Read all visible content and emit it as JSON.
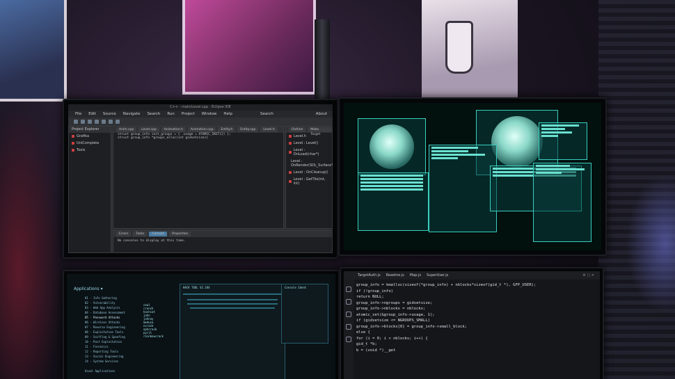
{
  "ide": {
    "window_title": "C++ - main/Level.cpp - Eclipse IDE",
    "menu": [
      "File",
      "Edit",
      "Source",
      "Navigate",
      "Search",
      "Run",
      "Project",
      "Window",
      "Help"
    ],
    "about_label": "About",
    "search_label": "Search",
    "project_explorer": {
      "title": "Project Explorer",
      "items": [
        "Grafika",
        "UniComplete",
        "Tools"
      ]
    },
    "editor_tabs": [
      "Anim.cpp",
      "Level.cpp",
      "Animation.h",
      "Animation.cpp",
      "Entity.h",
      "Entity.cpp",
      "Level.h"
    ],
    "code_lines": [
      "struct group_info init_groups = { .usage = ATOMIC_INIT(2) };",
      "struct group_info *groups_alloc(int gidsetsize){"
    ],
    "outline": {
      "tabs": [
        "Outline",
        "Make Target"
      ],
      "items": [
        "Level.h",
        "Level : Level()",
        "Level : OnLoad(char*)",
        "Level : OnRender(SDL_Surface*)",
        "Level : OnCleanup()",
        "Level : GetTile(int, int)"
      ]
    },
    "bottom_tabs": [
      "Errors",
      "Tasks",
      "Console",
      "Properties"
    ],
    "console_message": "No consoles to display at this time."
  },
  "apps": {
    "title": "Applications",
    "menu_items": [
      "01 - Info Gathering",
      "02 - Vulnerability",
      "03 - Web App Analysis",
      "04 - Database Assessment",
      "05 - Password Attacks",
      "06 - Wireless Attacks",
      "07 - Reverse Engineering",
      "08 - Exploitation Tools",
      "09 - Sniffing & Spoofing",
      "10 - Post Exploitation",
      "11 - Forensics",
      "12 - Reporting Tools",
      "13 - Social Engineering",
      "14 - System Services",
      "Usual Applications"
    ],
    "sub_items": [
      "cewl",
      "crunch",
      "hashcat",
      "john",
      "johnny",
      "medusa",
      "ncrack",
      "ophcrack",
      "pyrit",
      "rainbowcrack"
    ],
    "terminal_title": "HACK TOOL V2.184",
    "side_title": "Console Ident"
  },
  "vscode": {
    "tabs": [
      "TargetAuth.js",
      "Readme.js",
      "Map.js",
      "SuperUser.js"
    ],
    "code_lines": [
      "group_info = kmalloc(sizeof(*group_info) + nblocks*sizeof(gid_t *), GFP_USER);",
      "if (!group_info)",
      "    return NULL;",
      "",
      "group_info->ngroups = gidsetsize;",
      "group_info->nblocks = nblocks;",
      "atomic_set(&group_info->usage, 1);",
      "",
      "if (gidsetsize <= NGROUPS_SMALL)",
      "    group_info->blocks[0] = group_info->small_block;",
      "else {",
      "    for (i = 0; i < nblocks; i++) {",
      "        gid_t *b;",
      "        b = (void *)__get"
    ]
  }
}
